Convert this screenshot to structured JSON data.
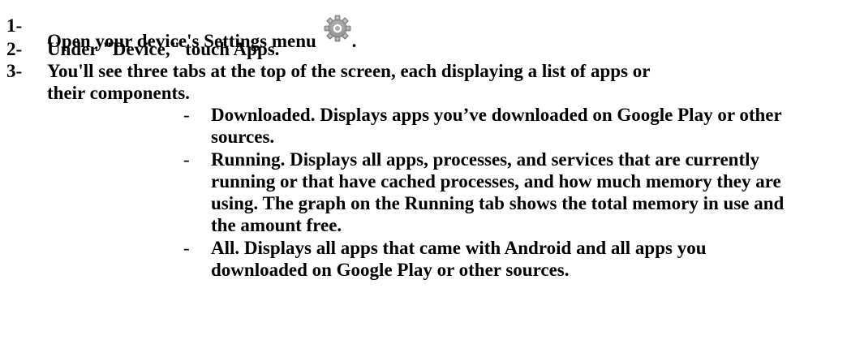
{
  "steps": [
    {
      "number": "1-",
      "text": "Open your device's Settings menu",
      "suffix": ".",
      "icon": "gear-icon"
    },
    {
      "number": "2-",
      "text": "Under \"Device,\" touch Apps."
    },
    {
      "number": "3-",
      "line1": "You'll see three tabs at the top of the screen, each displaying a list of apps or",
      "line2": "their components."
    }
  ],
  "bullets": [
    {
      "dash": "-",
      "lines": [
        "Downloaded. Displays apps you’ve downloaded on Google Play or other",
        "sources."
      ]
    },
    {
      "dash": "-",
      "lines": [
        "Running. Displays all apps, processes, and services that are currently",
        "running or that have cached processes, and how much memory they are",
        "using. The graph on the Running tab shows the total memory in use and",
        "the amount free."
      ]
    },
    {
      "dash": "-",
      "lines": [
        "All. Displays all apps that came with Android and all apps you",
        "downloaded on Google Play or other sources."
      ]
    }
  ],
  "colors": {
    "text": "#000000",
    "background": "#ffffff",
    "gear": "#9a9a9a"
  }
}
